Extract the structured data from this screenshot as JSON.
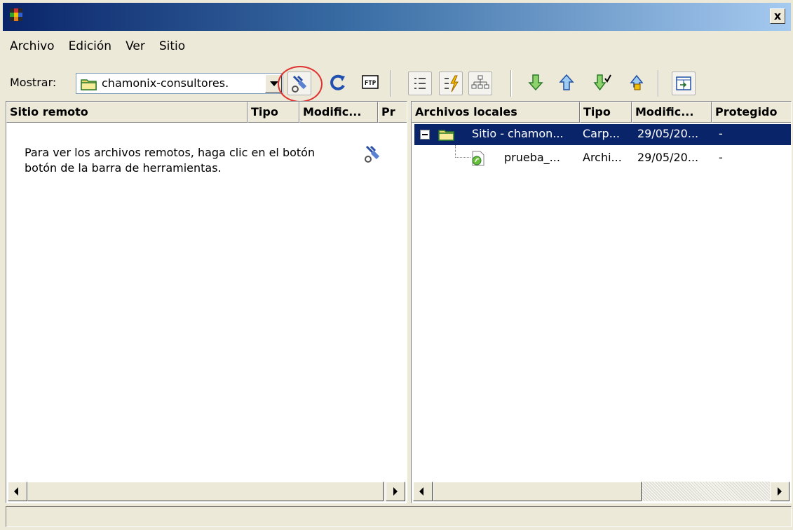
{
  "window": {
    "close_label": "x"
  },
  "menu": [
    {
      "label": "Archivo"
    },
    {
      "label": "Edición"
    },
    {
      "label": "Ver"
    },
    {
      "label": "Sitio"
    }
  ],
  "toolbar": {
    "show_label": "Mostrar:",
    "site_value": "chamonix-consultores.",
    "buttons": [
      {
        "name": "connect",
        "icon": "connect-icon"
      },
      {
        "name": "refresh",
        "icon": "refresh-icon"
      },
      {
        "name": "ftp-log",
        "icon": "ftp-icon"
      },
      {
        "name": "view-details",
        "icon": "list-view-icon"
      },
      {
        "name": "site-files",
        "icon": "lightning-icon"
      },
      {
        "name": "site-map",
        "icon": "sitemap-icon"
      },
      {
        "name": "get",
        "icon": "down-arrow-icon"
      },
      {
        "name": "put",
        "icon": "up-arrow-icon"
      },
      {
        "name": "check-out",
        "icon": "checkout-icon"
      },
      {
        "name": "check-in",
        "icon": "checkin-icon"
      },
      {
        "name": "expand",
        "icon": "expand-icon"
      }
    ],
    "highlight_color": "#e03030"
  },
  "remote_panel": {
    "columns": [
      "Sitio remoto",
      "Tipo",
      "Modific...",
      "Pr"
    ],
    "message_line1": "Para ver los archivos remotos, haga clic en el botón",
    "message_line2": "botón de la barra de herramientas."
  },
  "local_panel": {
    "columns": [
      "Archivos locales",
      "Tipo",
      "Modific...",
      "Protegido"
    ],
    "rows": [
      {
        "name": "Sitio - chamon...",
        "type": "Carp...",
        "modified": "29/05/20...",
        "checked": "-",
        "selected": true
      },
      {
        "name": "prueba_...",
        "type": "Archi...",
        "modified": "29/05/20...",
        "checked": "-",
        "selected": false
      }
    ]
  },
  "colors": {
    "selection": "#0a246a",
    "face": "#ece9d8"
  }
}
